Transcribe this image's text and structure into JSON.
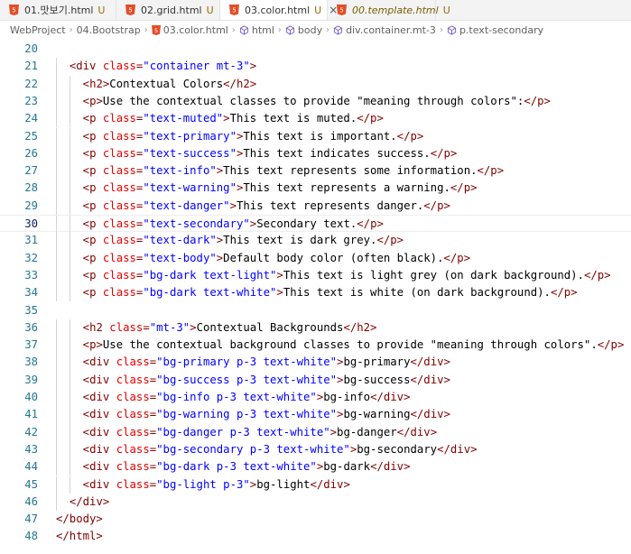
{
  "tabs": [
    {
      "label": "01.맛보기.html",
      "status": "U",
      "active": false,
      "preview": false
    },
    {
      "label": "02.grid.html",
      "status": "U",
      "active": false,
      "preview": false
    },
    {
      "label": "03.color.html",
      "status": "U",
      "active": true,
      "preview": false,
      "close": "×"
    },
    {
      "label": "00.template.html",
      "status": "U",
      "active": false,
      "preview": true
    }
  ],
  "breadcrumb": [
    "WebProject",
    "04.Bootstrap",
    "03.color.html",
    "html",
    "body",
    "div.container.mt-3",
    "p.text-secondary"
  ],
  "editor": {
    "current_line": 30,
    "lines": [
      {
        "n": "20",
        "indent": 0,
        "tokens": []
      },
      {
        "n": "21",
        "indent": 2,
        "tokens": [
          [
            "t",
            "<div "
          ],
          [
            "a",
            "class"
          ],
          [
            "t",
            "="
          ],
          [
            "v",
            "\"container mt-3\""
          ],
          [
            "t",
            ">"
          ]
        ]
      },
      {
        "n": "22",
        "indent": 3,
        "tokens": [
          [
            "t",
            "<h2>"
          ],
          [
            "x",
            "Contextual Colors"
          ],
          [
            "t",
            "</h2>"
          ]
        ]
      },
      {
        "n": "23",
        "indent": 3,
        "tokens": [
          [
            "t",
            "<p>"
          ],
          [
            "x",
            "Use the contextual classes to provide \"meaning through colors\":"
          ],
          [
            "t",
            "</p>"
          ]
        ]
      },
      {
        "n": "24",
        "indent": 3,
        "tokens": [
          [
            "t",
            "<p "
          ],
          [
            "a",
            "class"
          ],
          [
            "t",
            "="
          ],
          [
            "v",
            "\"text-muted\""
          ],
          [
            "t",
            ">"
          ],
          [
            "x",
            "This text is muted."
          ],
          [
            "t",
            "</p>"
          ]
        ]
      },
      {
        "n": "25",
        "indent": 3,
        "tokens": [
          [
            "t",
            "<p "
          ],
          [
            "a",
            "class"
          ],
          [
            "t",
            "="
          ],
          [
            "v",
            "\"text-primary\""
          ],
          [
            "t",
            ">"
          ],
          [
            "x",
            "This text is important."
          ],
          [
            "t",
            "</p>"
          ]
        ]
      },
      {
        "n": "26",
        "indent": 3,
        "tokens": [
          [
            "t",
            "<p "
          ],
          [
            "a",
            "class"
          ],
          [
            "t",
            "="
          ],
          [
            "v",
            "\"text-success\""
          ],
          [
            "t",
            ">"
          ],
          [
            "x",
            "This text indicates success."
          ],
          [
            "t",
            "</p>"
          ]
        ]
      },
      {
        "n": "27",
        "indent": 3,
        "tokens": [
          [
            "t",
            "<p "
          ],
          [
            "a",
            "class"
          ],
          [
            "t",
            "="
          ],
          [
            "v",
            "\"text-info\""
          ],
          [
            "t",
            ">"
          ],
          [
            "x",
            "This text represents some information."
          ],
          [
            "t",
            "</p>"
          ]
        ]
      },
      {
        "n": "28",
        "indent": 3,
        "tokens": [
          [
            "t",
            "<p "
          ],
          [
            "a",
            "class"
          ],
          [
            "t",
            "="
          ],
          [
            "v",
            "\"text-warning\""
          ],
          [
            "t",
            ">"
          ],
          [
            "x",
            "This text represents a warning."
          ],
          [
            "t",
            "</p>"
          ]
        ]
      },
      {
        "n": "29",
        "indent": 3,
        "tokens": [
          [
            "t",
            "<p "
          ],
          [
            "a",
            "class"
          ],
          [
            "t",
            "="
          ],
          [
            "v",
            "\"text-danger\""
          ],
          [
            "t",
            ">"
          ],
          [
            "x",
            "This text represents danger."
          ],
          [
            "t",
            "</p>"
          ]
        ]
      },
      {
        "n": "30",
        "indent": 3,
        "tokens": [
          [
            "t",
            "<p "
          ],
          [
            "a",
            "class"
          ],
          [
            "t",
            "="
          ],
          [
            "v",
            "\"text-secondary\""
          ],
          [
            "t",
            ">"
          ],
          [
            "x",
            "Secondary text."
          ],
          [
            "t",
            "</p>"
          ]
        ]
      },
      {
        "n": "31",
        "indent": 3,
        "tokens": [
          [
            "t",
            "<p "
          ],
          [
            "a",
            "class"
          ],
          [
            "t",
            "="
          ],
          [
            "v",
            "\"text-dark\""
          ],
          [
            "t",
            ">"
          ],
          [
            "x",
            "This text is dark grey."
          ],
          [
            "t",
            "</p>"
          ]
        ]
      },
      {
        "n": "32",
        "indent": 3,
        "tokens": [
          [
            "t",
            "<p "
          ],
          [
            "a",
            "class"
          ],
          [
            "t",
            "="
          ],
          [
            "v",
            "\"text-body\""
          ],
          [
            "t",
            ">"
          ],
          [
            "x",
            "Default body color (often black)."
          ],
          [
            "t",
            "</p>"
          ]
        ]
      },
      {
        "n": "33",
        "indent": 3,
        "tokens": [
          [
            "t",
            "<p "
          ],
          [
            "a",
            "class"
          ],
          [
            "t",
            "="
          ],
          [
            "v",
            "\"bg-dark text-light\""
          ],
          [
            "t",
            ">"
          ],
          [
            "x",
            "This text is light grey (on dark background)."
          ],
          [
            "t",
            "</p>"
          ]
        ]
      },
      {
        "n": "34",
        "indent": 3,
        "tokens": [
          [
            "t",
            "<p "
          ],
          [
            "a",
            "class"
          ],
          [
            "t",
            "="
          ],
          [
            "v",
            "\"bg-dark text-white\""
          ],
          [
            "t",
            ">"
          ],
          [
            "x",
            "This text is white (on dark background)."
          ],
          [
            "t",
            "</p>"
          ]
        ]
      },
      {
        "n": "35",
        "indent": 0,
        "tokens": []
      },
      {
        "n": "36",
        "indent": 3,
        "tokens": [
          [
            "t",
            "<h2 "
          ],
          [
            "a",
            "class"
          ],
          [
            "t",
            "="
          ],
          [
            "v",
            "\"mt-3\""
          ],
          [
            "t",
            ">"
          ],
          [
            "x",
            "Contextual Backgrounds"
          ],
          [
            "t",
            "</h2>"
          ]
        ]
      },
      {
        "n": "37",
        "indent": 3,
        "tokens": [
          [
            "t",
            "<p>"
          ],
          [
            "x",
            "Use the contextual background classes to provide \"meaning through colors\"."
          ],
          [
            "t",
            "</p>"
          ]
        ]
      },
      {
        "n": "38",
        "indent": 3,
        "tokens": [
          [
            "t",
            "<div "
          ],
          [
            "a",
            "class"
          ],
          [
            "t",
            "="
          ],
          [
            "v",
            "\"bg-primary p-3 text-white\""
          ],
          [
            "t",
            ">"
          ],
          [
            "x",
            "bg-primary"
          ],
          [
            "t",
            "</div>"
          ]
        ]
      },
      {
        "n": "39",
        "indent": 3,
        "tokens": [
          [
            "t",
            "<div "
          ],
          [
            "a",
            "class"
          ],
          [
            "t",
            "="
          ],
          [
            "v",
            "\"bg-success p-3 text-white\""
          ],
          [
            "t",
            ">"
          ],
          [
            "x",
            "bg-success"
          ],
          [
            "t",
            "</div>"
          ]
        ]
      },
      {
        "n": "40",
        "indent": 3,
        "tokens": [
          [
            "t",
            "<div "
          ],
          [
            "a",
            "class"
          ],
          [
            "t",
            "="
          ],
          [
            "v",
            "\"bg-info p-3 text-white\""
          ],
          [
            "t",
            ">"
          ],
          [
            "x",
            "bg-info"
          ],
          [
            "t",
            "</div>"
          ]
        ]
      },
      {
        "n": "41",
        "indent": 3,
        "tokens": [
          [
            "t",
            "<div "
          ],
          [
            "a",
            "class"
          ],
          [
            "t",
            "="
          ],
          [
            "v",
            "\"bg-warning p-3 text-white\""
          ],
          [
            "t",
            ">"
          ],
          [
            "x",
            "bg-warning"
          ],
          [
            "t",
            "</div>"
          ]
        ]
      },
      {
        "n": "42",
        "indent": 3,
        "tokens": [
          [
            "t",
            "<div "
          ],
          [
            "a",
            "class"
          ],
          [
            "t",
            "="
          ],
          [
            "v",
            "\"bg-danger p-3 text-white\""
          ],
          [
            "t",
            ">"
          ],
          [
            "x",
            "bg-danger"
          ],
          [
            "t",
            "</div>"
          ]
        ]
      },
      {
        "n": "43",
        "indent": 3,
        "tokens": [
          [
            "t",
            "<div "
          ],
          [
            "a",
            "class"
          ],
          [
            "t",
            "="
          ],
          [
            "v",
            "\"bg-secondary p-3 text-white\""
          ],
          [
            "t",
            ">"
          ],
          [
            "x",
            "bg-secondary"
          ],
          [
            "t",
            "</div>"
          ]
        ]
      },
      {
        "n": "44",
        "indent": 3,
        "tokens": [
          [
            "t",
            "<div "
          ],
          [
            "a",
            "class"
          ],
          [
            "t",
            "="
          ],
          [
            "v",
            "\"bg-dark p-3 text-white\""
          ],
          [
            "t",
            ">"
          ],
          [
            "x",
            "bg-dark"
          ],
          [
            "t",
            "</div>"
          ]
        ]
      },
      {
        "n": "45",
        "indent": 3,
        "tokens": [
          [
            "t",
            "<div "
          ],
          [
            "a",
            "class"
          ],
          [
            "t",
            "="
          ],
          [
            "v",
            "\"bg-light p-3\""
          ],
          [
            "t",
            ">"
          ],
          [
            "x",
            "bg-light"
          ],
          [
            "t",
            "</div>"
          ]
        ]
      },
      {
        "n": "46",
        "indent": 2,
        "tokens": [
          [
            "t",
            "</div>"
          ]
        ]
      },
      {
        "n": "47",
        "indent": 1,
        "tokens": [
          [
            "t",
            "</body>"
          ]
        ]
      },
      {
        "n": "48",
        "indent": 1,
        "tokens": [
          [
            "t",
            "</html>"
          ]
        ]
      }
    ]
  },
  "colors": {
    "tag": "#800000",
    "attr": "#e50000",
    "value": "#0000ff",
    "text": "#000000",
    "line_number": "#237893",
    "html_icon": "#e44d26"
  },
  "icons": {
    "tab_file": "html5-icon",
    "breadcrumb_file": "html5-icon",
    "breadcrumb_element": "cube-icon",
    "breadcrumb_separator": "chevron-right-icon"
  }
}
